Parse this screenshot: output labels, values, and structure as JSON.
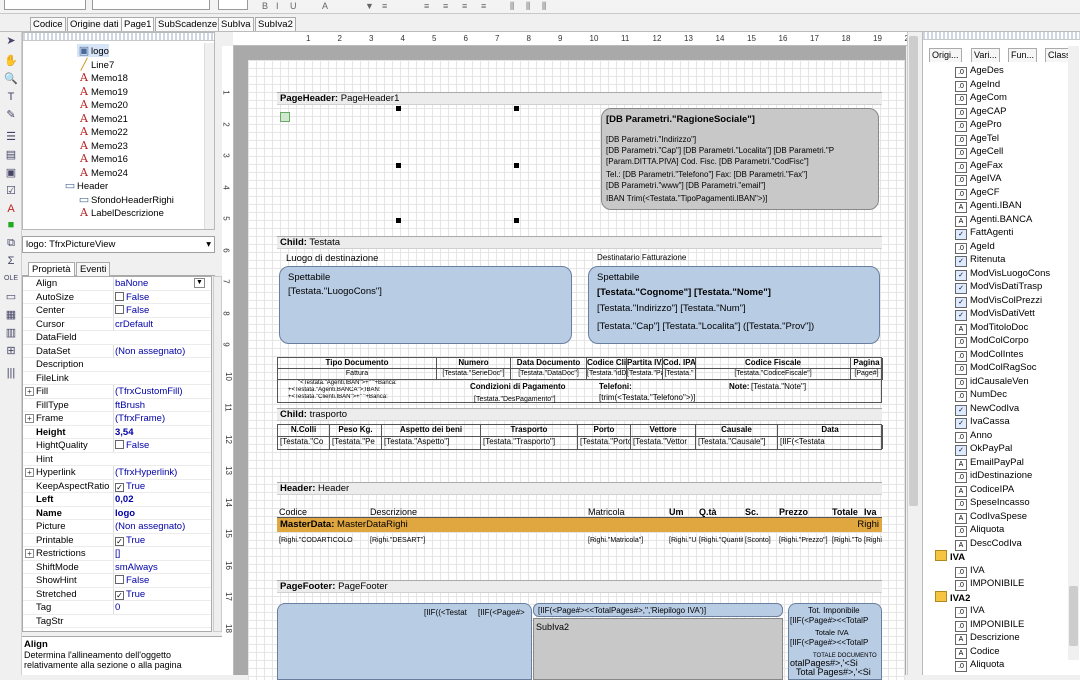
{
  "page_tabs": [
    "Codice",
    "Origine dati",
    "Page1",
    "SubScadenze",
    "SubIva",
    "SubIva2"
  ],
  "tree": {
    "items": [
      {
        "label": "logo",
        "icon": "image-icon",
        "indent": 2,
        "selected": true
      },
      {
        "label": "Line7",
        "icon": "line-icon",
        "indent": 2
      },
      {
        "label": "Memo18",
        "icon": "text-icon",
        "indent": 2
      },
      {
        "label": "Memo19",
        "icon": "text-icon",
        "indent": 2
      },
      {
        "label": "Memo20",
        "icon": "text-icon",
        "indent": 2
      },
      {
        "label": "Memo21",
        "icon": "text-icon",
        "indent": 2
      },
      {
        "label": "Memo22",
        "icon": "text-icon",
        "indent": 2
      },
      {
        "label": "Memo23",
        "icon": "text-icon",
        "indent": 2
      },
      {
        "label": "Memo16",
        "icon": "text-icon",
        "indent": 2
      },
      {
        "label": "Memo24",
        "icon": "text-icon",
        "indent": 2
      },
      {
        "label": "Header",
        "icon": "band-icon",
        "indent": 1
      },
      {
        "label": "SfondoHeaderRighi",
        "icon": "shape-icon",
        "indent": 2
      },
      {
        "label": "LabelDescrizione",
        "icon": "text-icon",
        "indent": 2
      }
    ]
  },
  "object_selector": "logo: TfrxPictureView",
  "prop_tabs": [
    "Proprietà",
    "Eventi"
  ],
  "properties": [
    {
      "k": "Align",
      "v": "baNone"
    },
    {
      "k": "AutoSize",
      "v": "False",
      "chk": false
    },
    {
      "k": "Center",
      "v": "False",
      "chk": false
    },
    {
      "k": "Cursor",
      "v": "crDefault"
    },
    {
      "k": "DataField",
      "v": ""
    },
    {
      "k": "DataSet",
      "v": "(Non assegnato)"
    },
    {
      "k": "Description",
      "v": ""
    },
    {
      "k": "FileLink",
      "v": ""
    },
    {
      "k": "Fill",
      "v": "(TfrxCustomFill)",
      "ex": true
    },
    {
      "k": "FillType",
      "v": "ftBrush"
    },
    {
      "k": "Frame",
      "v": "(TfrxFrame)",
      "ex": true
    },
    {
      "k": "Height",
      "v": "3,54",
      "bold": true
    },
    {
      "k": "HightQuality",
      "v": "False",
      "chk": false
    },
    {
      "k": "Hint",
      "v": ""
    },
    {
      "k": "Hyperlink",
      "v": "(TfrxHyperlink)",
      "ex": true
    },
    {
      "k": "KeepAspectRatio",
      "v": "True",
      "chk": true
    },
    {
      "k": "Left",
      "v": "0,02",
      "bold": true
    },
    {
      "k": "Name",
      "v": "logo",
      "bold": true
    },
    {
      "k": "Picture",
      "v": "(Non assegnato)"
    },
    {
      "k": "Printable",
      "v": "True",
      "chk": true
    },
    {
      "k": "Restrictions",
      "v": "[]",
      "ex": true
    },
    {
      "k": "ShiftMode",
      "v": "smAlways"
    },
    {
      "k": "ShowHint",
      "v": "False",
      "chk": false
    },
    {
      "k": "Stretched",
      "v": "True",
      "chk": true
    },
    {
      "k": "Tag",
      "v": "0"
    },
    {
      "k": "TagStr",
      "v": ""
    }
  ],
  "help": {
    "title": "Align",
    "text": "Determina l'allineamento dell'oggetto relativamente alla sezione o alla pagina"
  },
  "ruler_numbers": [
    "1",
    "2",
    "3",
    "4",
    "5",
    "6",
    "7",
    "8",
    "9",
    "10",
    "11",
    "12",
    "13",
    "14",
    "15",
    "16",
    "17",
    "18",
    "19",
    "20"
  ],
  "vruler_numbers": [
    "1",
    "2",
    "3",
    "4",
    "5",
    "6",
    "7",
    "8",
    "9",
    "10",
    "11",
    "12",
    "13",
    "14",
    "15",
    "16",
    "17",
    "18"
  ],
  "report": {
    "page_header": {
      "title": "PageHeader:",
      "name": "PageHeader1"
    },
    "company": {
      "name": "[DB Parametri.\"RagioneSociale\"]",
      "lines": [
        "[DB Parametri.\"Indirizzo\"]",
        "[DB Parametri.\"Cap\"] [DB Parametri.\"Localita\"] [DB Parametri.\"P",
        "[Param.DITTA.PIVA]  Cod. Fisc. [DB Parametri.\"CodFisc\"]",
        "Tel.: [DB Parametri.\"Telefono\"] Fax: [DB Parametri.\"Fax\"]",
        "[DB Parametri.\"www\"] [DB Parametri.\"email\"]",
        "IBAN  Trim(<Testata.\"TipoPagamenti.IBAN\">)]"
      ]
    },
    "child_testata": {
      "title": "Child:",
      "name": "Testata"
    },
    "luogo_label": "Luogo di destinazione",
    "destinatario_label": "Destinatario Fatturazione",
    "spettabile": "Spettabile",
    "luogo_value": "[Testata.\"LuogoCons\"]",
    "dest_lines": [
      "[Testata.\"Cognome\"] [Testata.\"Nome\"]",
      "[Testata.\"Indirizzo\"] [Testata.\"Num\"]",
      "[Testata.\"Cap\"] [Testata.\"Localita\"] ([Testata.\"Prov\"])"
    ],
    "doc_headers": [
      "Tipo Documento",
      "Numero",
      "Data Documento",
      "Codice Cliente",
      "Partita IVA",
      "Cod. IPA",
      "Codice Fiscale",
      "Pagina"
    ],
    "doc_values": [
      "Fattura",
      "[Testata.\"SerieDoc\"]",
      "[Testata.\"DataDoc\"]",
      "[Testata.\"idDitta",
      "[Testata.\"Pati",
      "[Testata.\"",
      "[Testata.\"CodiceFiscale\"]",
      "[Page#]"
    ],
    "bank_lines": [
      "\"<Testata.\"Agenti.IBAN\">+\" \"+Banca:",
      "+<Testata.\"Agenti.BANCA\">;IBAN:",
      "+<Testata.\"Clienti.IBAN\">+\" \"+Banca:"
    ],
    "cond_pag_label": "Condizioni di Pagamento",
    "cond_pag_value": "[Testata.\"DesPagamento\"]",
    "telefoni_label": "Telefoni:",
    "telefoni_value": "[trim(<Testata.\"Telefono\">)]",
    "note_label": "Note:",
    "note_value": "[Testata.\"Note\"]",
    "child_trasporto": {
      "title": "Child:",
      "name": "trasporto"
    },
    "trasp_headers": [
      "N.Colli",
      "Peso Kg.",
      "Aspetto dei beni",
      "Trasporto",
      "Porto",
      "Vettore",
      "Causale",
      "Data"
    ],
    "trasp_values": [
      "[Testata.\"Co",
      "[Testata.\"Pe",
      "[Testata.\"Aspetto\"]",
      "[Testata.\"Trasporto\"]",
      "[Testata.\"Porto\"]",
      "[Testata.\"Vettor",
      "[Testata.\"Causale\"]",
      "[IIF(<Testata"
    ],
    "header_band": {
      "title": "Header:",
      "name": "Header"
    },
    "righe_headers": [
      "Codice",
      "Descrizione",
      "Matricola",
      "Um",
      "Q.tà",
      "Sc.",
      "Prezzo",
      "Totale",
      "Iva"
    ],
    "master": {
      "title": "MasterData:",
      "name": "MasterDataRighi",
      "dataset": "Righi"
    },
    "righe_values": [
      "[Righi.\"CODARTICOLO",
      "[Righi.\"DESART\"]",
      "[Righi.\"Matricola\"]",
      "[Righi.\"UM\"]",
      "[Righi.\"Quantita\"]",
      "[Sconto]",
      "[Righi.\"Prezzo\"]",
      "[Righi.\"Totale\"]",
      "[Righi.\"A"
    ],
    "page_footer": {
      "title": "PageFooter:",
      "name": "PageFooter"
    },
    "footer_texts": [
      "[IIF((<Testat",
      "[IIF(<Page#>",
      "[IIF(<Page#><<TotalPages#>,'','Riepilogo IVA')]",
      "SubIva2",
      "Tot. Imponibile",
      "[IIF(<Page#><<TotalP",
      "Totale IVA",
      "[IIF(<Page#><<TotalP",
      "TOTALE DOCUMENTO",
      "otalPages#>,'<Si",
      "Total Pages#>,'<Si"
    ]
  },
  "right_panel": {
    "tabs": [
      "Origi...",
      "Vari...",
      "Fun...",
      "Classi"
    ],
    "fields": [
      {
        "label": "AgeDes",
        "icon": "field-icon"
      },
      {
        "label": "AgeInd",
        "icon": "field-icon"
      },
      {
        "label": "AgeCom",
        "icon": "field-icon"
      },
      {
        "label": "AgeCAP",
        "icon": "field-icon"
      },
      {
        "label": "AgePro",
        "icon": "field-icon"
      },
      {
        "label": "AgeTel",
        "icon": "field-icon"
      },
      {
        "label": "AgeCell",
        "icon": "field-icon"
      },
      {
        "label": "AgeFax",
        "icon": "field-icon"
      },
      {
        "label": "AgeIVA",
        "icon": "field-icon"
      },
      {
        "label": "AgeCF",
        "icon": "field-icon"
      },
      {
        "label": "Agenti.IBAN",
        "icon": "text-field-icon"
      },
      {
        "label": "Agenti.BANCA",
        "icon": "text-field-icon"
      },
      {
        "label": "FattAgenti",
        "icon": "bool-field-icon"
      },
      {
        "label": "AgeId",
        "icon": "field-icon"
      },
      {
        "label": "Ritenuta",
        "icon": "bool-field-icon"
      },
      {
        "label": "ModVisLuogoCons",
        "icon": "bool-field-icon"
      },
      {
        "label": "ModVisDatiTrasp",
        "icon": "bool-field-icon"
      },
      {
        "label": "ModVisColPrezzi",
        "icon": "bool-field-icon"
      },
      {
        "label": "ModVisDatiVett",
        "icon": "bool-field-icon"
      },
      {
        "label": "ModTitoloDoc",
        "icon": "text-field-icon"
      },
      {
        "label": "ModColCorpo",
        "icon": "field-icon"
      },
      {
        "label": "ModColIntes",
        "icon": "field-icon"
      },
      {
        "label": "ModColRagSoc",
        "icon": "field-icon"
      },
      {
        "label": "idCausaleVen",
        "icon": "field-icon"
      },
      {
        "label": "NumDec",
        "icon": "field-icon"
      },
      {
        "label": "NewCodIva",
        "icon": "bool-field-icon"
      },
      {
        "label": "IvaCassa",
        "icon": "bool-field-icon"
      },
      {
        "label": "Anno",
        "icon": "field-icon"
      },
      {
        "label": "OkPayPal",
        "icon": "bool-field-icon"
      },
      {
        "label": "EmailPayPal",
        "icon": "text-field-icon"
      },
      {
        "label": "idDestinazione",
        "icon": "field-icon"
      },
      {
        "label": "CodiceIPA",
        "icon": "text-field-icon"
      },
      {
        "label": "SpeseIncasso",
        "icon": "field-icon"
      },
      {
        "label": "CodIvaSpese",
        "icon": "text-field-icon"
      },
      {
        "label": "Aliquota",
        "icon": "field-icon"
      },
      {
        "label": "DescCodIva",
        "icon": "text-field-icon"
      },
      {
        "label": "IVA",
        "icon": "dataset-icon",
        "group": true
      },
      {
        "label": "IVA",
        "icon": "field-icon"
      },
      {
        "label": "IMPONIBILE",
        "icon": "field-icon"
      },
      {
        "label": "IVA2",
        "icon": "dataset-icon",
        "group": true
      },
      {
        "label": "IVA",
        "icon": "field-icon"
      },
      {
        "label": "IMPONIBILE",
        "icon": "field-icon"
      },
      {
        "label": "Descrizione",
        "icon": "text-field-icon"
      },
      {
        "label": "Codice",
        "icon": "text-field-icon"
      },
      {
        "label": "Aliquota",
        "icon": "field-icon"
      }
    ]
  },
  "colors": {
    "band_bg": "#ececec",
    "box_blue": "#b8cce4",
    "box_gray": "#c8c8c8",
    "master_orange": "#e0a640"
  }
}
